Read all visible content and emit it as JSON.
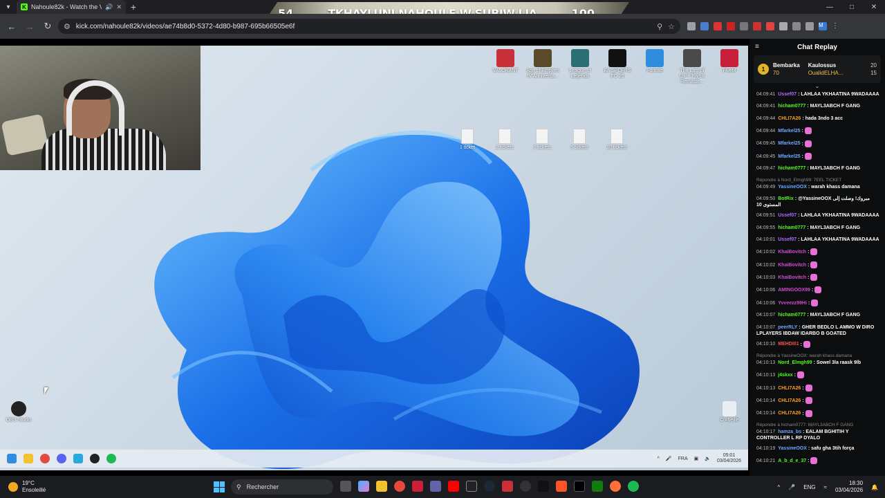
{
  "browser": {
    "tab_title": "Nahoule82k - Watch the VO",
    "tab_favicon": "K",
    "url": "kick.com/nahoule82k/videos/ae74b8d0-5372-4d80-b987-695b66505e6f",
    "profile_initial": "M"
  },
  "banner": {
    "left_number": "54",
    "text": "TKHAYLUNI NAHOULE W SUBIW LIA",
    "right_number": "100"
  },
  "desktop": {
    "icons": [
      {
        "label": "VALORANT",
        "color": "#c8303a"
      },
      {
        "label": "Age of Empires IV Anniversa...",
        "color": "#5a4a2a"
      },
      {
        "label": "League of Legends",
        "color": "#2b6f74"
      },
      {
        "label": "EA SPORTS FC 26",
        "color": "#111111"
      },
      {
        "label": "Fortnite",
        "color": "#2f8de0"
      },
      {
        "label": "The Last of Us™ Part II Remaste...",
        "color": "#4a4a4a"
      },
      {
        "label": "FiveM",
        "color": "#c8203a"
      }
    ],
    "files": [
      {
        "label": "1 ticket"
      },
      {
        "label": "2 tickets"
      },
      {
        "label": "3 tickets"
      },
      {
        "label": "5 tickets"
      },
      {
        "label": "10 tickets"
      }
    ],
    "obs_label": "OBS Studio",
    "recycle_label": "Corbeille",
    "inner_tray": {
      "lang": "FRA",
      "time": "05:01",
      "date": "03/04/2026"
    }
  },
  "chat": {
    "title": "Chat Replay",
    "leader_first_name": "Bembarka",
    "leader_first_score": "70",
    "leader_second_name": "Kaulossus",
    "leader_second_score": "20",
    "leader_third_name": "OualidELHA...",
    "leader_third_score": "15",
    "messages": [
      {
        "time": "04:09:41",
        "user": "Ussef07",
        "color": "#b36bff",
        "text": "LAHLAA YKHAATINA 9WADAAAA"
      },
      {
        "time": "04:09:41",
        "user": "hicham0777",
        "color": "#53fc18",
        "text": "MAYL3ABCH F GANG"
      },
      {
        "time": "04:09:44",
        "user": "CHLI7A26",
        "color": "#ff9d1f",
        "text": "hada 3ndo 3 acc"
      },
      {
        "time": "04:09:44",
        "user": "Mfarkel25",
        "color": "#6fa8ff",
        "text": ""
      },
      {
        "time": "04:09:45",
        "user": "Mfarkel25",
        "color": "#6fa8ff",
        "text": ""
      },
      {
        "time": "04:09:45",
        "user": "Mfarkel25",
        "color": "#6fa8ff",
        "text": ""
      },
      {
        "time": "04:09:47",
        "user": "hicham0777",
        "color": "#53fc18",
        "text": "MAYL3ABCH F GANG"
      },
      {
        "time": "04:09:49",
        "user": "YassineOOX",
        "color": "#6fa8ff",
        "text": "warah khass damana",
        "reply": "Répondre à Nord_Elmgh99: 7EEL TICKET"
      },
      {
        "time": "04:09:50",
        "user": "BotRix",
        "color": "#53fc18",
        "text": "@YassineOOX مبروك! وصلت إلى المستوى 10",
        "wrap": true
      },
      {
        "time": "04:09:51",
        "user": "Ussef07",
        "color": "#b36bff",
        "text": "LAHLAA YKHAATINA 9WADAAAA"
      },
      {
        "time": "04:09:55",
        "user": "hicham0777",
        "color": "#53fc18",
        "text": "MAYL3ABCH F GANG"
      },
      {
        "time": "04:10:01",
        "user": "Ussef07",
        "color": "#b36bff",
        "text": "LAHLAA YKHAATINA 9WADAAAA"
      },
      {
        "time": "04:10:02",
        "user": "KhaiBovitch",
        "color": "#d04bd0",
        "text": ""
      },
      {
        "time": "04:10:02",
        "user": "KhaiBovitch",
        "color": "#d04bd0",
        "text": ""
      },
      {
        "time": "04:10:03",
        "user": "KhaiBovitch",
        "color": "#d04bd0",
        "text": ""
      },
      {
        "time": "04:10:06",
        "user": "AMINGOOX99",
        "color": "#d04bd0",
        "text": ""
      },
      {
        "time": "04:10:06",
        "user": "Yvveezz99Hi",
        "color": "#d04bd0",
        "text": ""
      },
      {
        "time": "04:10:07",
        "user": "hicham0777",
        "color": "#53fc18",
        "text": "MAYL3ABCH F GANG"
      },
      {
        "time": "04:10:07",
        "user": "peerRLY",
        "color": "#6fa8ff",
        "text": "GHER BEDLO L AMMO W DIRO LPLAYERS IBDAW IDARBO B GOATED",
        "wrap": true
      },
      {
        "time": "04:10:10",
        "user": "MEHDI01",
        "color": "#ff4f4f",
        "text": ""
      },
      {
        "time": "04:10:13",
        "user": "Nord_Elmgh99",
        "color": "#53fc18",
        "text": "Sowel 3la raask 9lb",
        "reply": "Répondre à YassineOOX: warah khass damana"
      },
      {
        "time": "04:10:13",
        "user": "j4skxx",
        "color": "#53fc18",
        "text": ""
      },
      {
        "time": "04:10:13",
        "user": "CHLI7A26",
        "color": "#ff9d1f",
        "text": ""
      },
      {
        "time": "04:10:14",
        "user": "CHLI7A26",
        "color": "#ff9d1f",
        "text": ""
      },
      {
        "time": "04:10:14",
        "user": "CHLI7A26",
        "color": "#ff9d1f",
        "text": ""
      },
      {
        "time": "04:10:17",
        "user": "hamza_bs",
        "color": "#6fa8ff",
        "text": "EALAM BGHITIH Y CONTROLLER L RP DYALO",
        "reply": "Répondre à hicham0777: MAYL3ABCH F GANG",
        "wrap": true
      },
      {
        "time": "04:10:19",
        "user": "YassineOOX",
        "color": "#6fa8ff",
        "text": "safu gha 3tih força"
      },
      {
        "time": "04:10:21",
        "user": "A_b_d_e_37",
        "color": "#53fc18",
        "text": ""
      }
    ]
  },
  "taskbar": {
    "temperature": "19°C",
    "weather": "Ensoleillé",
    "search_placeholder": "Rechercher",
    "lang": "ENG",
    "time": "18:30",
    "date": "03/04/2026"
  }
}
